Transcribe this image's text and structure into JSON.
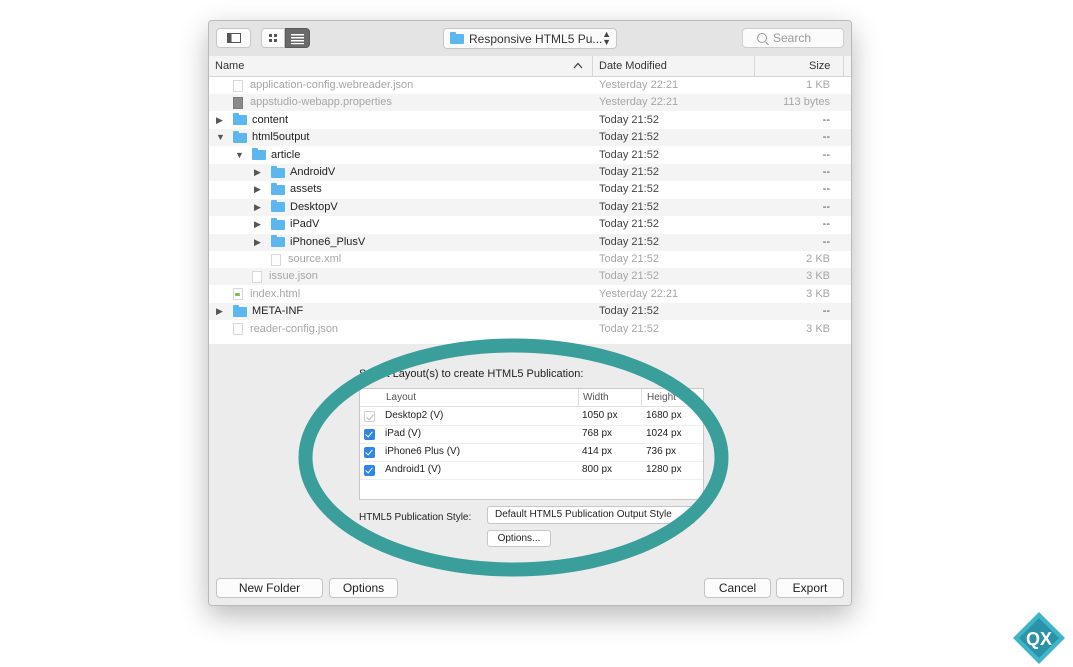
{
  "toolbar": {
    "path_label": "Responsive HTML5 Pu...",
    "search_placeholder": "Search"
  },
  "columns": {
    "name": "Name",
    "date": "Date Modified",
    "size": "Size"
  },
  "files": [
    {
      "name": "application-config.webreader.json",
      "date": "Yesterday 22:21",
      "size": "1 KB",
      "kind": "doc",
      "indent": 0,
      "dim": true
    },
    {
      "name": "appstudio-webapp.properties",
      "date": "Yesterday 22:21",
      "size": "113 bytes",
      "kind": "doc-dark",
      "indent": 0,
      "dim": true
    },
    {
      "name": "content",
      "date": "Today 21:52",
      "size": "--",
      "kind": "folder",
      "indent": 0,
      "disclosure": "collapsed"
    },
    {
      "name": "html5output",
      "date": "Today 21:52",
      "size": "--",
      "kind": "folder",
      "indent": 0,
      "disclosure": "expanded"
    },
    {
      "name": "article",
      "date": "Today 21:52",
      "size": "--",
      "kind": "folder",
      "indent": 1,
      "disclosure": "expanded"
    },
    {
      "name": "AndroidV",
      "date": "Today 21:52",
      "size": "--",
      "kind": "folder",
      "indent": 2,
      "disclosure": "collapsed"
    },
    {
      "name": "assets",
      "date": "Today 21:52",
      "size": "--",
      "kind": "folder",
      "indent": 2,
      "disclosure": "collapsed"
    },
    {
      "name": "DesktopV",
      "date": "Today 21:52",
      "size": "--",
      "kind": "folder",
      "indent": 2,
      "disclosure": "collapsed"
    },
    {
      "name": "iPadV",
      "date": "Today 21:52",
      "size": "--",
      "kind": "folder",
      "indent": 2,
      "disclosure": "collapsed"
    },
    {
      "name": "iPhone6_PlusV",
      "date": "Today 21:52",
      "size": "--",
      "kind": "folder",
      "indent": 2,
      "disclosure": "collapsed"
    },
    {
      "name": "source.xml",
      "date": "Today 21:52",
      "size": "2 KB",
      "kind": "doc",
      "indent": 2,
      "dim": true
    },
    {
      "name": "issue.json",
      "date": "Today 21:52",
      "size": "3 KB",
      "kind": "doc",
      "indent": 1,
      "dim": true
    },
    {
      "name": "index.html",
      "date": "Yesterday 22:21",
      "size": "3 KB",
      "kind": "doc-html",
      "indent": 0,
      "dim": true
    },
    {
      "name": "META-INF",
      "date": "Today 21:52",
      "size": "--",
      "kind": "folder",
      "indent": 0,
      "disclosure": "collapsed"
    },
    {
      "name": "reader-config.json",
      "date": "Today 21:52",
      "size": "3 KB",
      "kind": "doc",
      "indent": 0,
      "dim": true
    }
  ],
  "layouts": {
    "instruction": "Select Layout(s) to create HTML5 Publication:",
    "headers": {
      "layout": "Layout",
      "width": "Width",
      "height": "Height"
    },
    "rows": [
      {
        "name": "Desktop2 (V)",
        "width": "1050 px",
        "height": "1680 px",
        "checked": true,
        "enabled": false
      },
      {
        "name": "iPad (V)",
        "width": "768 px",
        "height": "1024 px",
        "checked": true,
        "enabled": true
      },
      {
        "name": "iPhone6 Plus (V)",
        "width": "414 px",
        "height": "736 px",
        "checked": true,
        "enabled": true
      },
      {
        "name": "Android1 (V)",
        "width": "800 px",
        "height": "1280 px",
        "checked": true,
        "enabled": true
      }
    ],
    "style_label": "HTML5 Publication Style:",
    "style_value": "Default HTML5 Publication Output Style",
    "options_small_label": "Options..."
  },
  "footer": {
    "new_folder": "New Folder",
    "options": "Options",
    "cancel": "Cancel",
    "export": "Export"
  },
  "logo": {
    "text": "QX"
  },
  "colors": {
    "highlight_ring": "#3a9e9b",
    "folder": "#5bb7ee",
    "checkbox": "#2f86e8"
  }
}
